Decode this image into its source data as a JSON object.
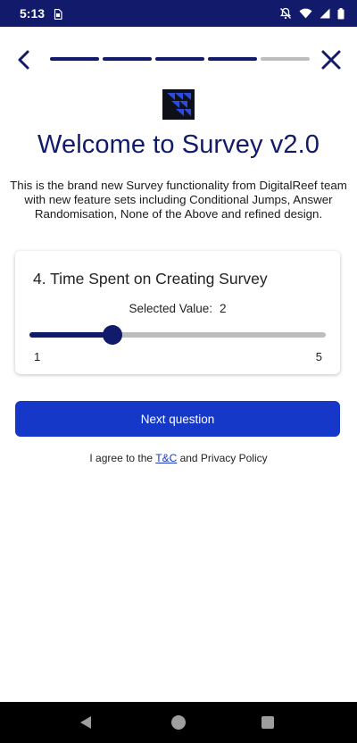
{
  "status_bar": {
    "time": "5:13",
    "icons": [
      "sim-card-icon",
      "notifications-off-icon",
      "wifi-icon",
      "signal-icon",
      "battery-icon"
    ]
  },
  "top_nav": {
    "back_icon": "chevron-left-icon",
    "close_icon": "close-icon",
    "progress_completed": 4,
    "progress_total": 5
  },
  "header": {
    "logo_icon": "digitalreef-logo-icon",
    "title": "Welcome to Survey v2.0",
    "intro": "This is the brand new Survey functionality from DigitalReef team with new feature sets including Conditional Jumps, Answer Randomisation, None of the Above and refined design."
  },
  "question": {
    "title": "4. Time Spent on Creating Survey",
    "selected_label": "Selected Value:",
    "selected_value": "2",
    "slider": {
      "min": 1,
      "max": 5,
      "value": 2
    },
    "min_label": "1",
    "max_label": "5"
  },
  "actions": {
    "next_label": "Next question"
  },
  "terms": {
    "prefix": "I agree to the ",
    "link": "T&C",
    "suffix": " and Privacy Policy"
  },
  "nav_bar": {
    "icons": [
      "back-triangle-icon",
      "home-circle-icon",
      "recents-square-icon"
    ]
  },
  "colors": {
    "primary_navy": "#111a6b",
    "button_blue": "#1538c8",
    "track_grey": "#bdbdbd"
  }
}
